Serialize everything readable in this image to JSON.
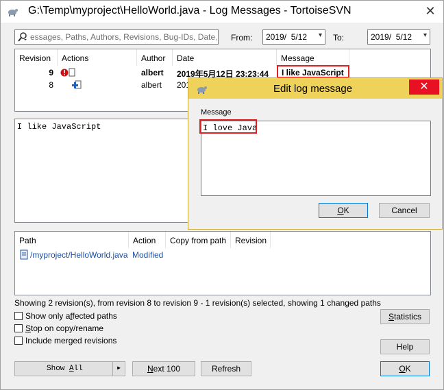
{
  "window": {
    "title": "G:\\Temp\\myproject\\HelloWorld.java - Log Messages - TortoiseSVN",
    "close_glyph": "✕"
  },
  "filter": {
    "placeholder": "essages, Paths, Authors, Revisions, Bug-IDs, Date,",
    "from_label": "From:",
    "from_value": "2019/  5/12",
    "to_label": "To:",
    "to_value": "2019/  5/12"
  },
  "log": {
    "columns": [
      "Revision",
      "Actions",
      "Author",
      "Date",
      "Message"
    ],
    "rows": [
      {
        "revision": "9",
        "author": "albert",
        "date": "2019年5月12日 23:23:44",
        "message": "I like JavaScript"
      },
      {
        "revision": "8",
        "author": "albert",
        "date": "201"
      }
    ]
  },
  "message_panel": {
    "text": "I like JavaScript"
  },
  "paths": {
    "columns": [
      "Path",
      "Action",
      "Copy from path",
      "Revision"
    ],
    "rows": [
      {
        "path": "/myproject/HelloWorld.java",
        "action": "Modified"
      }
    ]
  },
  "status_text": "Showing 2 revision(s), from revision 8 to revision 9 - 1 revision(s) selected, showing 1 changed paths",
  "options": {
    "affected_pre": "Show only a",
    "affected_u": "f",
    "affected_post": "fected paths",
    "stop_pre": "",
    "stop_u": "S",
    "stop_post": "top on copy/rename",
    "merged": "Include merged revisions"
  },
  "buttons": {
    "statistics_pre": "",
    "statistics_u": "S",
    "statistics_post": "tatistics",
    "help": "Help",
    "show_all_pre": "Show ",
    "show_all_u": "A",
    "show_all_post": "ll",
    "show_all_arrow": "▶",
    "next_pre": "",
    "next_u": "N",
    "next_post": "ext 100",
    "refresh": "Refresh",
    "ok_pre": "",
    "ok_u": "O",
    "ok_post": "K"
  },
  "dialog": {
    "title": "Edit log message",
    "close_glyph": "✕",
    "label": "Message",
    "value": "I love Java",
    "ok_pre": "",
    "ok_u": "O",
    "ok_post": "K",
    "cancel": "Cancel"
  },
  "colors": {
    "highlight": "#e02020",
    "dialog_frame": "#eed25a",
    "link_blue": "#1a4fa0"
  }
}
